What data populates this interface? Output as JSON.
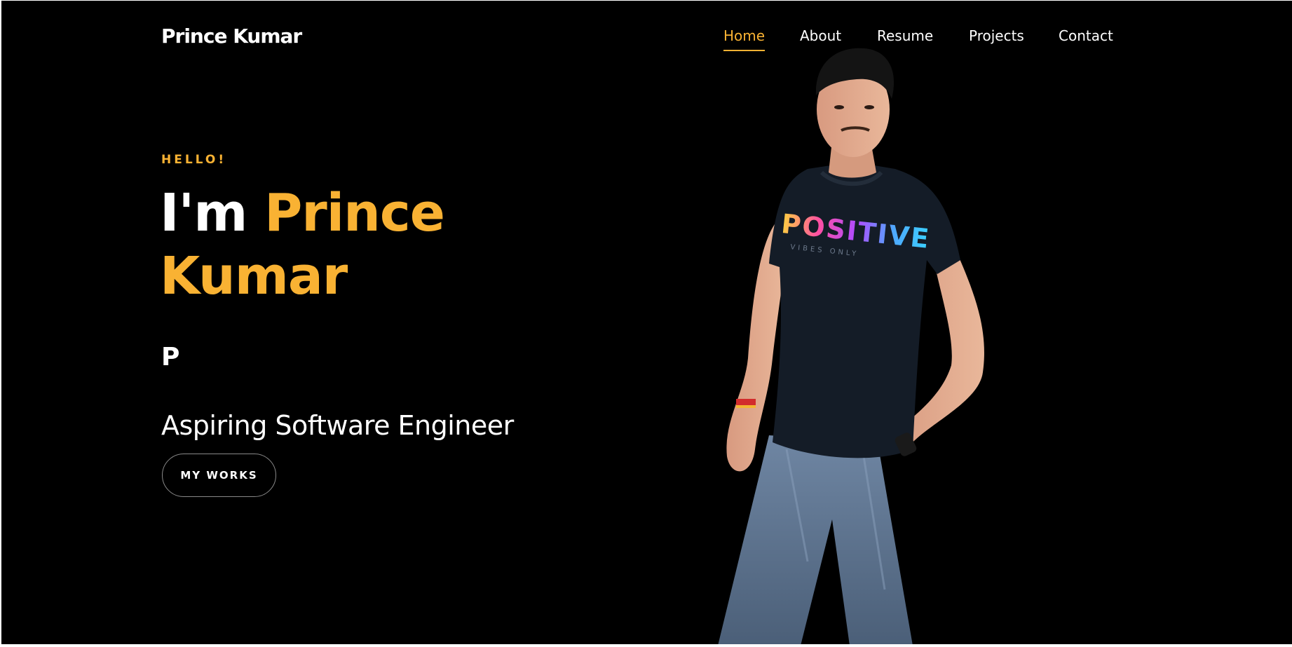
{
  "brand": {
    "name": "Prince Kumar"
  },
  "nav": {
    "items": [
      {
        "label": "Home",
        "active": true
      },
      {
        "label": "About",
        "active": false
      },
      {
        "label": "Resume",
        "active": false
      },
      {
        "label": "Projects",
        "active": false
      },
      {
        "label": "Contact",
        "active": false
      }
    ]
  },
  "hero": {
    "greeting": "HELLO!",
    "headline_prefix": "I'm",
    "headline_first": "Prince",
    "headline_last": "Kumar",
    "typed_text": "P",
    "tagline": "Aspiring Software Engineer",
    "cta_label": "MY WORKS",
    "shirt_print": "POSITIVE",
    "shirt_subprint": "VIBES ONLY"
  },
  "colors": {
    "accent": "#f9b233",
    "background": "#000000",
    "text": "#ffffff"
  }
}
